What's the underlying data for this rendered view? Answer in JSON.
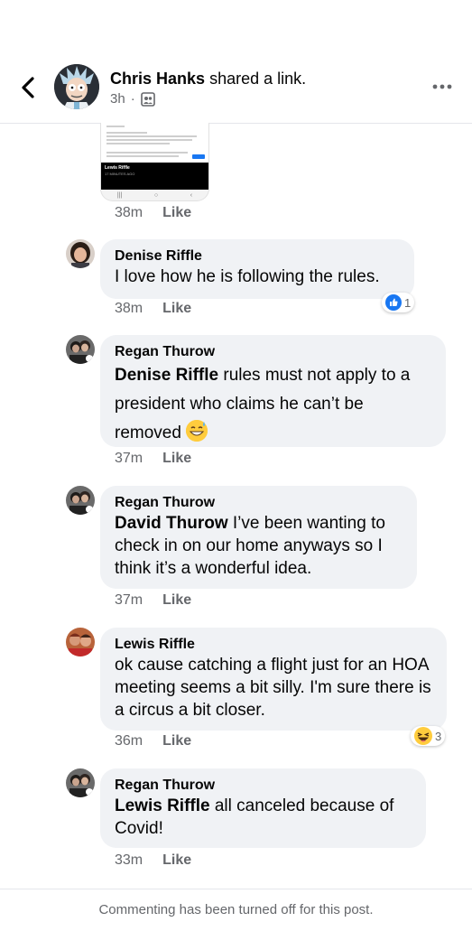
{
  "header": {
    "author": "Chris Hanks",
    "action": "shared a link.",
    "time": "3h",
    "separator": "·",
    "audience_icon": "group-icon"
  },
  "shared_image": {
    "name": "Lewis Riffle",
    "time": "17 MINUTES AGO"
  },
  "first_meta": {
    "time": "38m",
    "like": "Like"
  },
  "comments": [
    {
      "author": "Denise Riffle",
      "mention": "",
      "text": "I love how he is following the rules.",
      "time": "38m",
      "like": "Like",
      "reaction_count": "1",
      "reaction_icon": "like-icon"
    },
    {
      "author": "Regan Thurow",
      "mention": "Denise Riffle",
      "text": "rules must not apply to a president who claims he can’t be removed",
      "time": "37m",
      "like": "Like",
      "emoji": "grinning-sweat-emoji"
    },
    {
      "author": "Regan Thurow",
      "mention": "David Thurow",
      "text": "I’ve been wanting to check in on our home anyways so I think it’s a wonderful idea.",
      "time": "37m",
      "like": "Like"
    },
    {
      "author": "Lewis Riffle",
      "mention": "",
      "text": "ok cause catching a flight just for an HOA meeting seems a bit silly. I'm sure there is a circus a bit closer.",
      "time": "36m",
      "like": "Like",
      "reaction_count": "3",
      "reaction_icon": "haha-icon"
    },
    {
      "author": "Regan Thurow",
      "mention": "Lewis Riffle",
      "text": "all canceled because of Covid!",
      "time": "33m",
      "like": "Like"
    }
  ],
  "footer": {
    "notice": "Commenting has been turned off for this post."
  },
  "colors": {
    "bubble": "#f0f2f5",
    "meta": "#65676b",
    "like_blue": "#1877f2",
    "emoji_yellow": "#ffcc3d"
  }
}
